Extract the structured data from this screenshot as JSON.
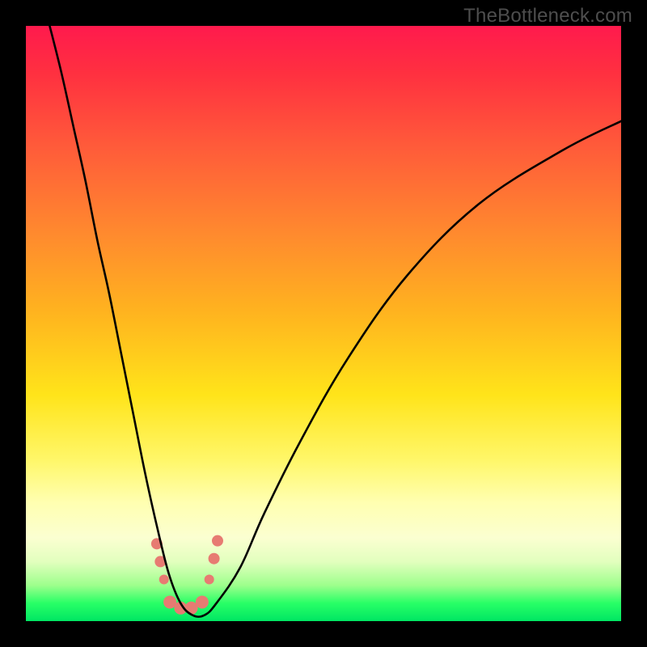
{
  "watermark": "TheBottleneck.com",
  "chart_data": {
    "type": "line",
    "title": "",
    "xlabel": "",
    "ylabel": "",
    "xlim": [
      0,
      100
    ],
    "ylim": [
      0,
      100
    ],
    "grid": false,
    "legend": false,
    "notes": "Bottleneck-style curve: vertical gradient red (top, high bottleneck) to green (bottom, low bottleneck). Black V-curve with minimum near x≈25. Salmon marker cluster near the trough.",
    "series": [
      {
        "name": "bottleneck-curve",
        "color": "#000000",
        "x": [
          4,
          6,
          8,
          10,
          12,
          14,
          16,
          18,
          20,
          22,
          24,
          26,
          28,
          30,
          32,
          36,
          40,
          46,
          54,
          64,
          76,
          90,
          100
        ],
        "y": [
          100,
          92,
          83,
          74,
          64,
          55,
          45,
          35,
          25,
          16,
          8,
          3,
          1,
          1,
          3,
          9,
          18,
          30,
          44,
          58,
          70,
          79,
          84
        ]
      }
    ],
    "markers": [
      {
        "x": 22.0,
        "y": 13.0,
        "r": 7,
        "color": "#e77b72"
      },
      {
        "x": 22.6,
        "y": 10.0,
        "r": 7,
        "color": "#e77b72"
      },
      {
        "x": 23.2,
        "y": 7.0,
        "r": 6,
        "color": "#e77b72"
      },
      {
        "x": 24.2,
        "y": 3.2,
        "r": 8,
        "color": "#e77b72"
      },
      {
        "x": 26.0,
        "y": 2.2,
        "r": 8,
        "color": "#e77b72"
      },
      {
        "x": 27.8,
        "y": 2.2,
        "r": 8,
        "color": "#e77b72"
      },
      {
        "x": 29.6,
        "y": 3.2,
        "r": 8,
        "color": "#e77b72"
      },
      {
        "x": 30.8,
        "y": 7.0,
        "r": 6,
        "color": "#e77b72"
      },
      {
        "x": 31.6,
        "y": 10.5,
        "r": 7,
        "color": "#e77b72"
      },
      {
        "x": 32.2,
        "y": 13.5,
        "r": 7,
        "color": "#e77b72"
      }
    ]
  }
}
